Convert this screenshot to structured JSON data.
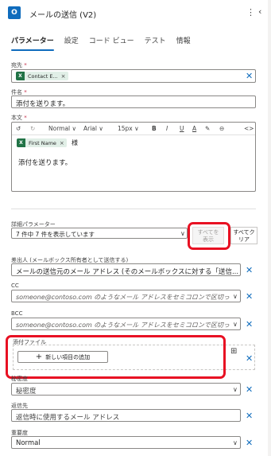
{
  "header": {
    "app_icon": "O",
    "title": "メールの送信 (V2)",
    "more_icon": "⋮",
    "collapse_icon": "‹"
  },
  "tabs": [
    {
      "label": "パラメーター",
      "active": true
    },
    {
      "label": "設定"
    },
    {
      "label": "コード ビュー"
    },
    {
      "label": "テスト"
    },
    {
      "label": "情報"
    }
  ],
  "to": {
    "label": "宛先",
    "token": "Contact E...",
    "token_icon": "X"
  },
  "subject": {
    "label": "件名",
    "value": "添付を送ります。"
  },
  "body": {
    "label": "本文",
    "toolbar": {
      "undo": "↺",
      "redo": "↻",
      "style": "Normal",
      "font": "Arial",
      "size": "15px",
      "bold": "B",
      "italic": "I",
      "underline": "U",
      "color": "A",
      "highlight": "✎",
      "link": "⊖",
      "code": "<>"
    },
    "token": "First Name",
    "token_suffix": "様",
    "text": "添付を送ります。"
  },
  "advanced": {
    "label": "詳細パラメーター",
    "select_value": "7 件中 7 件を表示しています",
    "show_all_line1": "すべてを",
    "show_all_line2": "表示",
    "clear_all_line1": "すべてク",
    "clear_all_line2": "リア"
  },
  "from": {
    "label": "差出人 (メールボックス所有者として送信する)",
    "value": "メールの送信元のメール アドレス (そのメールボックスに対する「送信..."
  },
  "cc": {
    "label": "CC",
    "placeholder": "someone@contoso.com のようなメール アドレスをセミコロンで区切って..."
  },
  "bcc": {
    "label": "BCC",
    "placeholder": "someone@contoso.com のようなメール アドレスをセミコロンで区切って..."
  },
  "attachments": {
    "label": "添付ファイル",
    "add_label": "新しい項目の追加",
    "add_icon": "+"
  },
  "sensitivity": {
    "label": "秘密度",
    "value": "秘密度"
  },
  "reply_to": {
    "label": "返信先",
    "value": "返信時に使用するメール アドレス"
  },
  "importance": {
    "label": "重要度",
    "value": "Normal"
  },
  "icons": {
    "remove": "×",
    "clear": "✕",
    "chevron": "∨",
    "switch_mode": "⊞"
  }
}
